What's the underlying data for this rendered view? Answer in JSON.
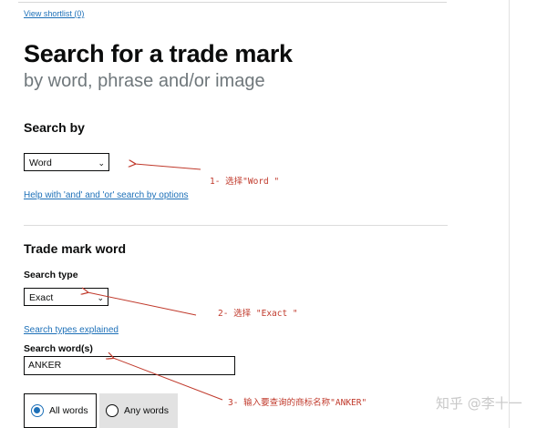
{
  "header": {
    "shortlist_link": "View shortlist (0)"
  },
  "page": {
    "title": "Search for a trade mark",
    "subtitle": "by word, phrase and/or image"
  },
  "search_by": {
    "heading": "Search by",
    "selected": "Word",
    "help_link": "Help with 'and' and 'or' search by options"
  },
  "trade_mark_word": {
    "heading": "Trade mark word",
    "search_type_label": "Search type",
    "search_type_selected": "Exact",
    "types_link": "Search types explained",
    "search_words_label": "Search word(s)",
    "search_words_value": "ANKER",
    "radio_all": "All words",
    "radio_any": "Any words"
  },
  "annotations": {
    "note1": "1- 选择\"Word \"",
    "note2": "2- 选择 \"Exact \"",
    "note3": "3- 输入要查询的商标名称\"ANKER\"",
    "color": "#c0392b"
  },
  "watermark": "知乎 @李十一",
  "colors": {
    "link": "#1d70b8",
    "text": "#0b0c0c",
    "secondary": "#6f777b"
  }
}
